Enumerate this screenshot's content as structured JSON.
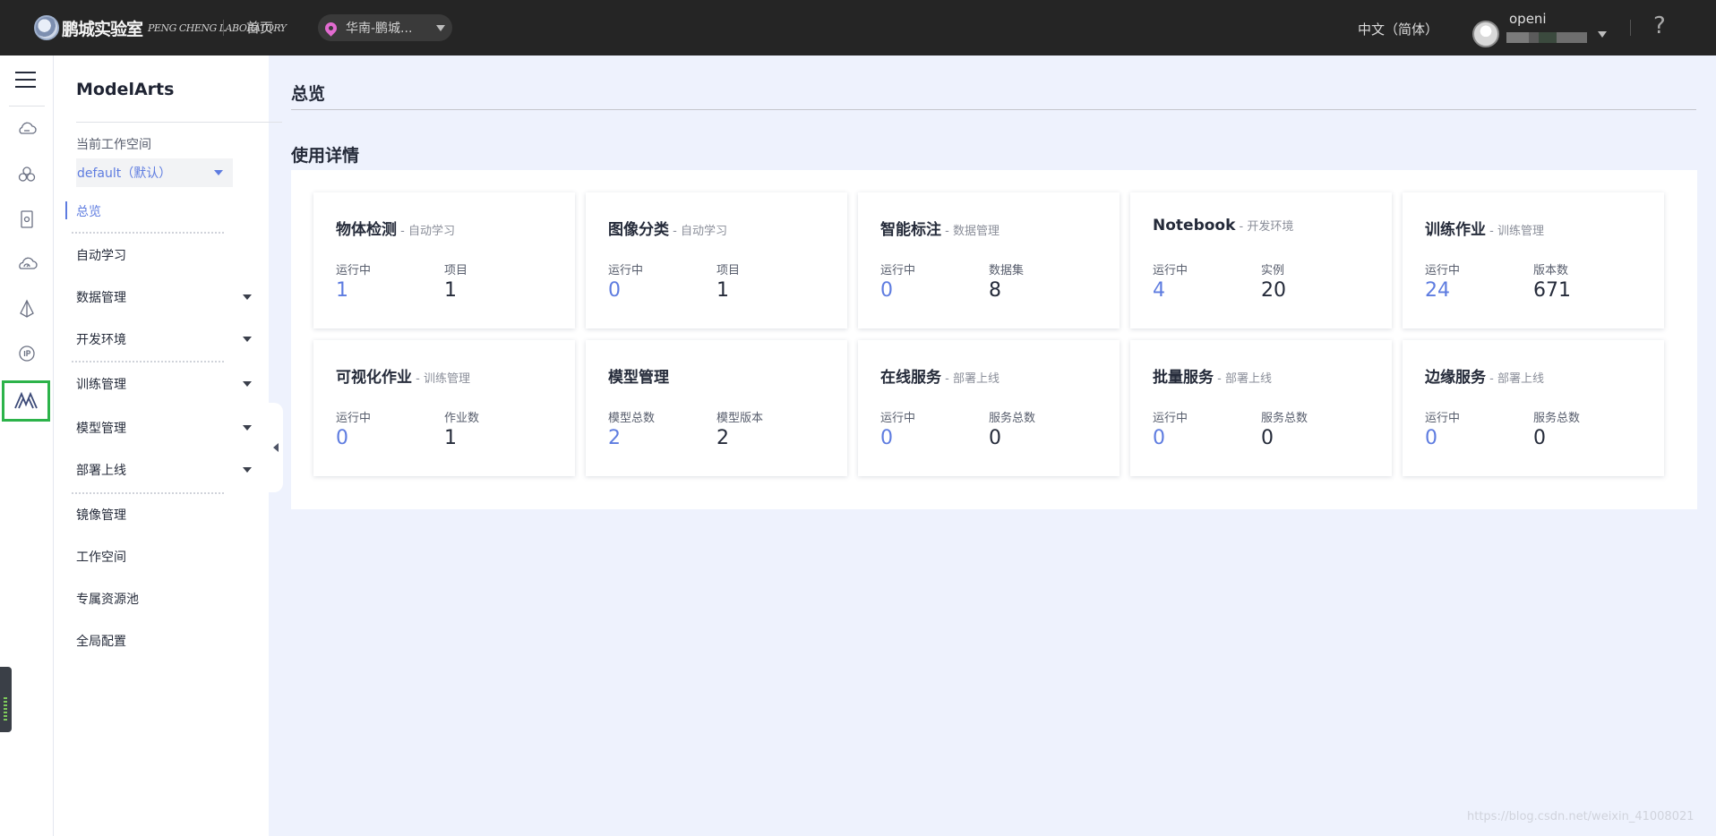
{
  "topbar": {
    "logo_text": "鹏城实验室",
    "logo_sub": "PENG CHENG LABORATORY",
    "home": "首页",
    "region": "华南-鹏城...",
    "language": "中文（简体）",
    "user_name": "openi",
    "help": "?"
  },
  "rail": {
    "items": [
      {
        "icon": "hamburger-icon"
      },
      {
        "icon": "cloud-storage-icon"
      },
      {
        "icon": "cluster-icon"
      },
      {
        "icon": "device-icon"
      },
      {
        "icon": "cloud-dashboard-icon"
      },
      {
        "icon": "prism-icon"
      },
      {
        "icon": "ip-icon"
      },
      {
        "icon": "modelarts-icon",
        "active": true
      }
    ]
  },
  "menu": {
    "title": "ModelArts",
    "workspace_label": "当前工作空间",
    "workspace_value": "default（默认）",
    "items": [
      {
        "label": "总览",
        "active": true
      },
      {
        "label": "自动学习"
      },
      {
        "label": "数据管理",
        "expandable": true
      },
      {
        "label": "开发环境",
        "expandable": true
      },
      {
        "label": "训练管理",
        "expandable": true
      },
      {
        "label": "模型管理",
        "expandable": true
      },
      {
        "label": "部署上线",
        "expandable": true
      },
      {
        "label": "镜像管理"
      },
      {
        "label": "工作空间"
      },
      {
        "label": "专属资源池"
      },
      {
        "label": "全局配置"
      }
    ]
  },
  "main": {
    "page_title": "总览",
    "section_title": "使用详情",
    "cards": [
      {
        "title": "物体检测",
        "sub": " - 自动学习",
        "stats": [
          {
            "label": "运行中",
            "value": "1",
            "link": true
          },
          {
            "label": "项目",
            "value": "1"
          }
        ]
      },
      {
        "title": "图像分类",
        "sub": " - 自动学习",
        "stats": [
          {
            "label": "运行中",
            "value": "0",
            "link": true
          },
          {
            "label": "项目",
            "value": "1"
          }
        ]
      },
      {
        "title": "智能标注",
        "sub": " - 数据管理",
        "stats": [
          {
            "label": "运行中",
            "value": "0",
            "link": true
          },
          {
            "label": "数据集",
            "value": "8"
          }
        ]
      },
      {
        "title": "Notebook",
        "sub": " - 开发环境",
        "stats": [
          {
            "label": "运行中",
            "value": "4",
            "link": true
          },
          {
            "label": "实例",
            "value": "20"
          }
        ]
      },
      {
        "title": "训练作业",
        "sub": " - 训练管理",
        "stats": [
          {
            "label": "运行中",
            "value": "24",
            "link": true
          },
          {
            "label": "版本数",
            "value": "671"
          }
        ]
      },
      {
        "title": "可视化作业",
        "sub": " - 训练管理",
        "stats": [
          {
            "label": "运行中",
            "value": "0",
            "link": true
          },
          {
            "label": "作业数",
            "value": "1"
          }
        ]
      },
      {
        "title": "模型管理",
        "sub": "",
        "stats": [
          {
            "label": "模型总数",
            "value": "2",
            "link": true
          },
          {
            "label": "模型版本",
            "value": "2"
          }
        ]
      },
      {
        "title": "在线服务",
        "sub": " - 部署上线",
        "stats": [
          {
            "label": "运行中",
            "value": "0",
            "link": true
          },
          {
            "label": "服务总数",
            "value": "0"
          }
        ]
      },
      {
        "title": "批量服务",
        "sub": " - 部署上线",
        "stats": [
          {
            "label": "运行中",
            "value": "0",
            "link": true
          },
          {
            "label": "服务总数",
            "value": "0"
          }
        ]
      },
      {
        "title": "边缘服务",
        "sub": " - 部署上线",
        "stats": [
          {
            "label": "运行中",
            "value": "0",
            "link": true
          },
          {
            "label": "服务总数",
            "value": "0"
          }
        ]
      }
    ]
  },
  "watermark": "https://blog.csdn.net/weixin_41008021",
  "colors": {
    "topbar": "#252525",
    "accent": "#5e7ce0",
    "page_bg": "#eef2fd",
    "active_rail_border": "#2cb34a"
  }
}
